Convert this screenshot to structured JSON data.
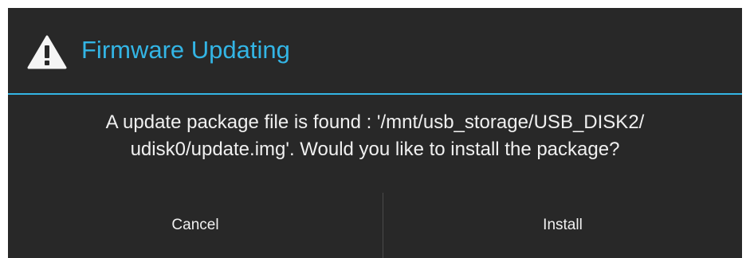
{
  "dialog": {
    "icon": "warning-icon",
    "title": "Firmware Updating",
    "accent_color": "#33b5e5",
    "background_color": "#282828",
    "message_lines": [
      "A update package file is found : '/mnt/usb_storage/USB_DISK2/",
      "udisk0/update.img'. Would you like to install the package?"
    ],
    "buttons": {
      "cancel_label": "Cancel",
      "install_label": "Install"
    }
  }
}
